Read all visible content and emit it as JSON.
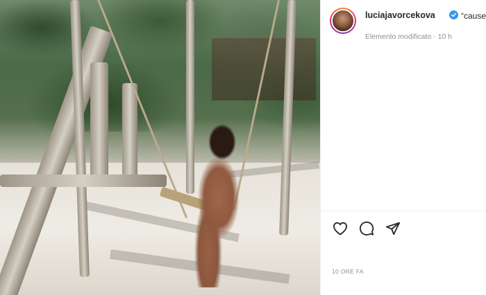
{
  "post": {
    "author": {
      "username": "luciajavorcekova",
      "verified": true,
      "avatar_icon": "profile-avatar"
    },
    "caption_preview": "“cause life",
    "edited_label": "Elemento modificato",
    "separator": "·",
    "edited_time": "10 h",
    "timestamp": "10 ORE FA",
    "actions": [
      {
        "name": "like",
        "icon": "heart-icon"
      },
      {
        "name": "comment",
        "icon": "comment-icon"
      },
      {
        "name": "share",
        "icon": "paper-plane-icon"
      }
    ]
  },
  "colors": {
    "text_primary": "#262626",
    "text_secondary": "#8e8e8e",
    "verified_blue": "#3897f0",
    "divider": "#efefef"
  }
}
